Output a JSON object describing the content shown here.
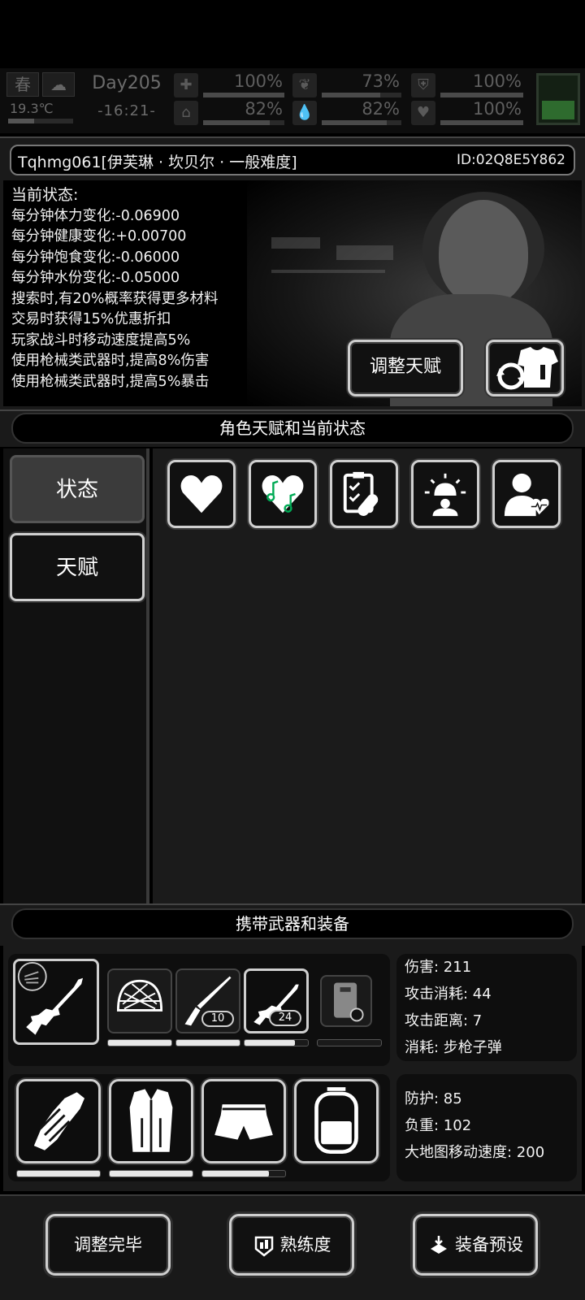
{
  "hud": {
    "season_icon": "spring-icon",
    "weather_icon": "cloudy-icon",
    "temperature": "19.3℃",
    "day": "Day205",
    "time": "-16:21-",
    "stats": [
      {
        "name": "stamina",
        "icon": "medkit-icon",
        "value": "100%",
        "fill": 100
      },
      {
        "name": "satiety",
        "icon": "stomach-icon",
        "value": "73%",
        "fill": 73
      },
      {
        "name": "armor",
        "icon": "armor-icon",
        "value": "100%",
        "fill": 100
      },
      {
        "name": "stamina2",
        "icon": "boot-icon",
        "value": "82%",
        "fill": 82
      },
      {
        "name": "water",
        "icon": "water-drop-icon",
        "value": "82%",
        "fill": 82
      },
      {
        "name": "health",
        "icon": "heart-icon",
        "value": "100%",
        "fill": 100
      }
    ],
    "battery_fill": 40
  },
  "character": {
    "name_line": "Tqhmg061[伊芙琳 · 坎贝尔 · 一般难度]",
    "id_line": "ID:02Q8E5Y862"
  },
  "status": {
    "header": "当前状态:",
    "lines": [
      "每分钟体力变化:-0.06900",
      "每分钟健康变化:+0.00700",
      "每分钟饱食变化:-0.06000",
      "每分钟水份变化:-0.05000",
      "搜索时,有20%概率获得更多材料",
      "交易时获得15%优惠折扣",
      "玩家战斗时移动速度提高5%",
      "使用枪械类武器时,提高8%伤害",
      "使用枪械类武器时,提高5%暴击"
    ],
    "adjust_talent_label": "调整天赋"
  },
  "talent_section": {
    "title": "角色天赋和当前状态",
    "tab_status": "状态",
    "tab_talent": "天赋",
    "icons": [
      "heart-icon",
      "music-heart-icon",
      "clipboard-pill-icon",
      "alarm-person-icon",
      "person-heartbeat-icon"
    ]
  },
  "equipment_section": {
    "title": "携带武器和装备",
    "weapon_counts": {
      "spear": "10",
      "rifle": "24"
    },
    "weapon_durability": [
      100,
      100,
      100,
      80,
      0
    ],
    "weapon_stats": {
      "damage": "伤害: 211",
      "attack_cost": "攻击消耗: 44",
      "attack_range": "攻击距离: 7",
      "consume": "消耗: 步枪子弹"
    },
    "gear_durability": [
      100,
      100,
      80
    ],
    "defense_stats": {
      "defense": "防护: 85",
      "load": "负重: 102",
      "map_speed": "大地图移动速度: 200"
    }
  },
  "bottom_buttons": {
    "done": "调整完毕",
    "proficiency": "熟练度",
    "preset": "装备预设"
  }
}
